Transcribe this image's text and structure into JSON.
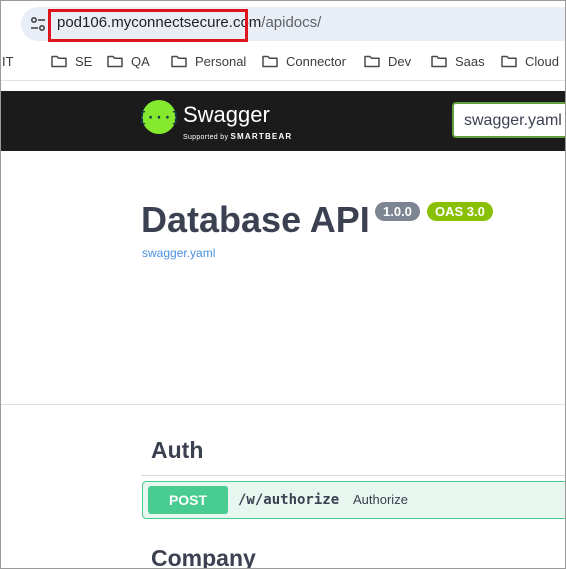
{
  "browser": {
    "url_host": "pod106.myconnectsecure.com",
    "url_path": "/apidocs/",
    "bookmarks": [
      {
        "label": "IT"
      },
      {
        "label": "SE"
      },
      {
        "label": "QA"
      },
      {
        "label": "Personal"
      },
      {
        "label": "Connector"
      },
      {
        "label": "Dev"
      },
      {
        "label": "Saas"
      },
      {
        "label": "Cloud"
      }
    ],
    "highlight_color": "#e0141e"
  },
  "topbar": {
    "brand": "Swagger",
    "supported_by": "Supported by",
    "smartbear": "SMARTBEAR",
    "spec_url_value": "swagger.yaml",
    "bg_color": "#1b1b1b",
    "logo_color": "#85ea2d"
  },
  "info": {
    "title": "Database API",
    "version": "1.0.0",
    "oas": "OAS 3.0",
    "spec_link": "swagger.yaml"
  },
  "sections": [
    {
      "name": "Auth",
      "operations": [
        {
          "method": "POST",
          "path": "/w/authorize",
          "summary": "Authorize",
          "color": "#49cc90"
        }
      ]
    },
    {
      "name": "Company",
      "operations": []
    }
  ]
}
